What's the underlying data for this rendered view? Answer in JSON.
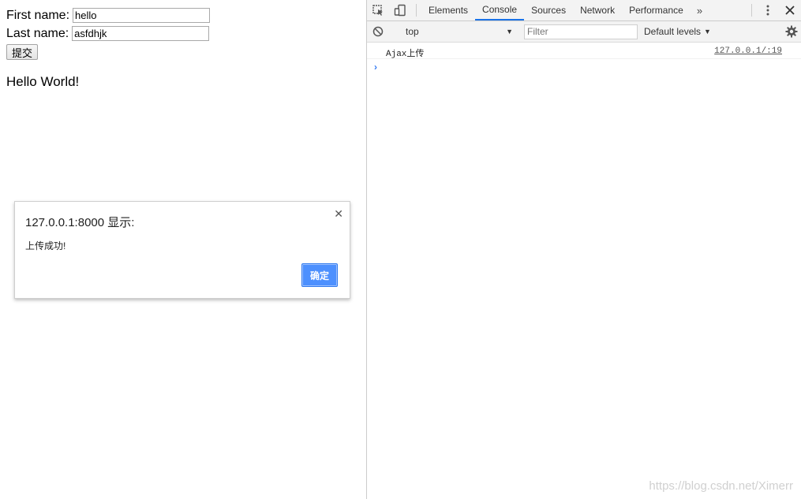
{
  "page": {
    "first_name_label": "First name:",
    "first_name_value": "hello",
    "last_name_label": "Last name:",
    "last_name_value": "asfdhjk",
    "submit_label": "提交",
    "hello_text": "Hello World!"
  },
  "alert": {
    "title": "127.0.0.1:8000 显示:",
    "message": "上传成功!",
    "ok_label": "确定",
    "close_glyph": "✕"
  },
  "devtools": {
    "tabs": [
      {
        "label": "Elements",
        "active": false
      },
      {
        "label": "Console",
        "active": true
      },
      {
        "label": "Sources",
        "active": false
      },
      {
        "label": "Network",
        "active": false
      },
      {
        "label": "Performance",
        "active": false
      }
    ],
    "more_tabs_glyph": "»",
    "context": "top",
    "filter_placeholder": "Filter",
    "levels_label": "Default levels",
    "console": {
      "message": "Ajax上传",
      "source": "127.0.0.1/:19",
      "prompt_glyph": "›"
    },
    "accent_color": "#1a73e8"
  },
  "watermark": "https://blog.csdn.net/Ximerr"
}
